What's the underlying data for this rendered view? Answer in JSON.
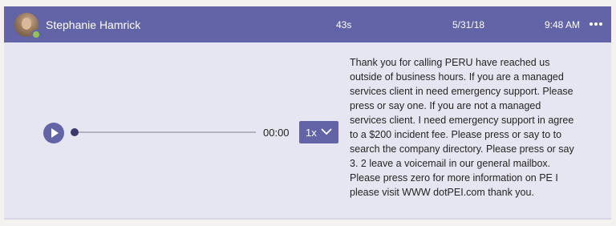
{
  "header": {
    "caller_name": "Stephanie Hamrick",
    "duration": "43s",
    "date": "5/31/18",
    "time": "9:48 AM"
  },
  "icons": {
    "more": "more-options-icon",
    "play": "play-icon",
    "chevron": "chevron-down-icon"
  },
  "colors": {
    "accent": "#6264a7",
    "presence_available": "#92c353",
    "card_background": "#e6e6f2"
  },
  "player": {
    "elapsed": "00:00",
    "speed_label": "1x",
    "progress_fraction": 0
  },
  "transcript": {
    "text": "Thank you for calling PERU have reached us outside of business hours. If you are a managed services client in need emergency support. Please press or say one. If you are not a managed services client. I need emergency support in agree to a $200 incident fee. Please press or say to to search the company directory. Please press or say 3. 2 leave a voicemail in our general mailbox. Please press zero for more information on PE I please visit WWW dotPEI.com thank you."
  }
}
